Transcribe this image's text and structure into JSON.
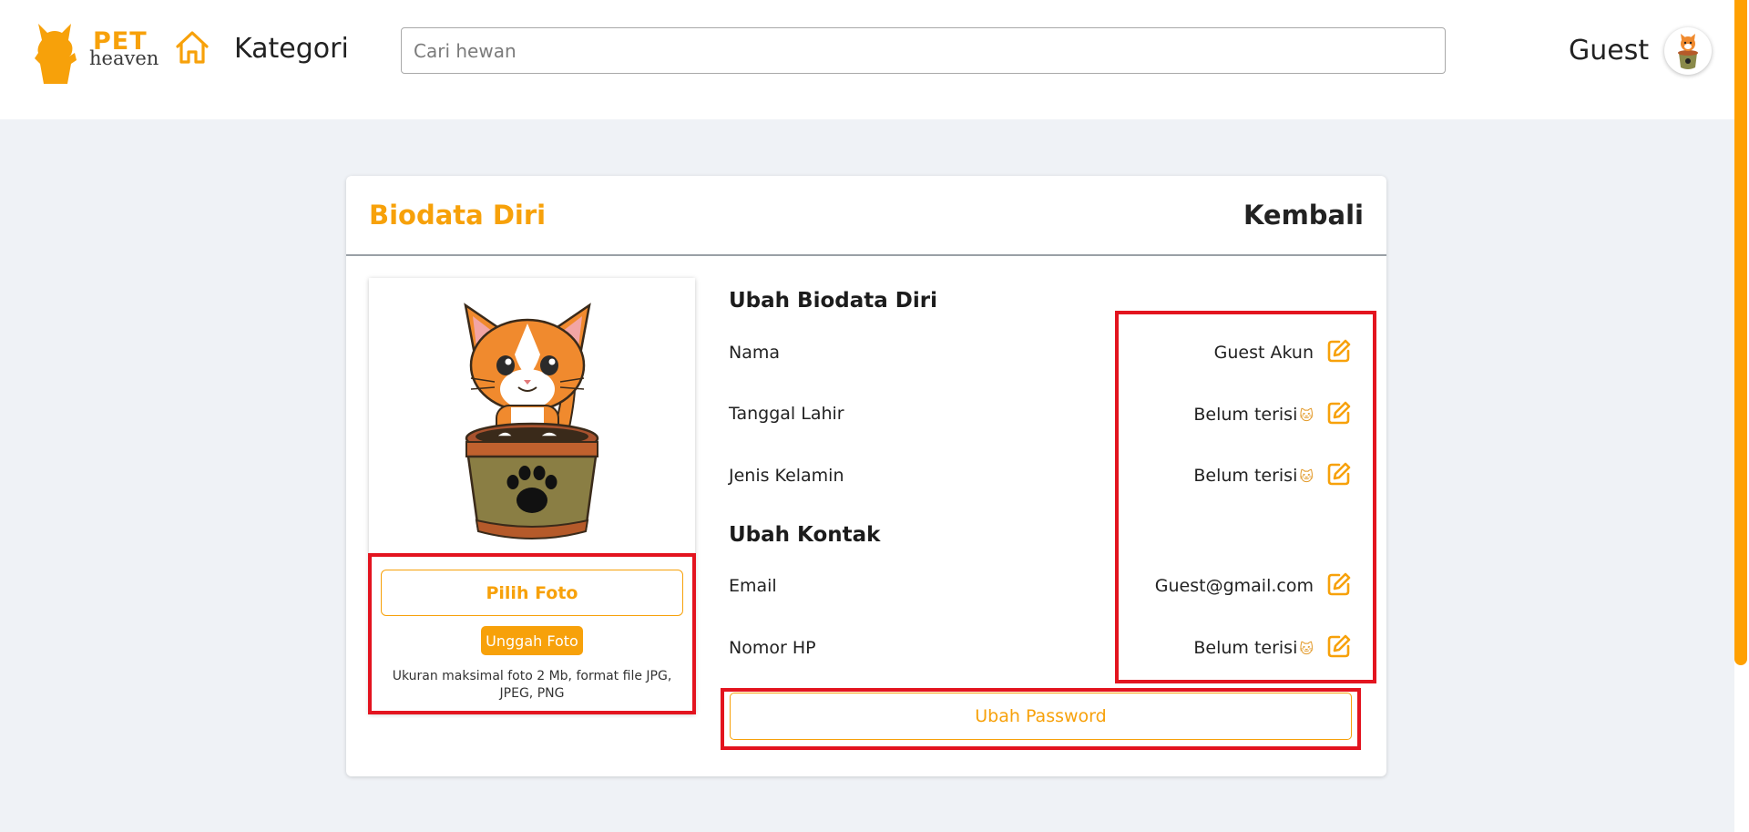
{
  "brand": {
    "name_top": "PET",
    "name_bottom": "heaven"
  },
  "nav": {
    "kategori": "Kategori"
  },
  "search": {
    "placeholder": "Cari hewan",
    "value": ""
  },
  "user": {
    "name": "Guest"
  },
  "card": {
    "title": "Biodata Diri",
    "back_label": "Kembali"
  },
  "photo": {
    "choose_label": "Pilih Foto",
    "upload_label": "Unggah Foto",
    "note": "Ukuran maksimal foto 2 Mb, format file JPG, JPEG, PNG"
  },
  "biodata": {
    "heading": "Ubah Biodata Diri",
    "rows": [
      {
        "label": "Nama",
        "value": "Guest Akun",
        "emoji": ""
      },
      {
        "label": "Tanggal Lahir",
        "value": "Belum terisi",
        "emoji": "🐱"
      },
      {
        "label": "Jenis Kelamin",
        "value": "Belum terisi",
        "emoji": "🐱"
      }
    ]
  },
  "contact": {
    "heading": "Ubah Kontak",
    "rows": [
      {
        "label": "Email",
        "value": "Guest@gmail.com",
        "emoji": ""
      },
      {
        "label": "Nomor HP",
        "value": "Belum terisi",
        "emoji": "🐱"
      }
    ]
  },
  "password": {
    "label": "Ubah Password"
  },
  "colors": {
    "accent": "#f7a10a",
    "highlight": "#e3141f",
    "background": "#eff2f6"
  },
  "icons": [
    "logo-cat-bucket",
    "home-icon",
    "avatar-cat",
    "edit-icon",
    "cat-in-bucket-illustration"
  ]
}
